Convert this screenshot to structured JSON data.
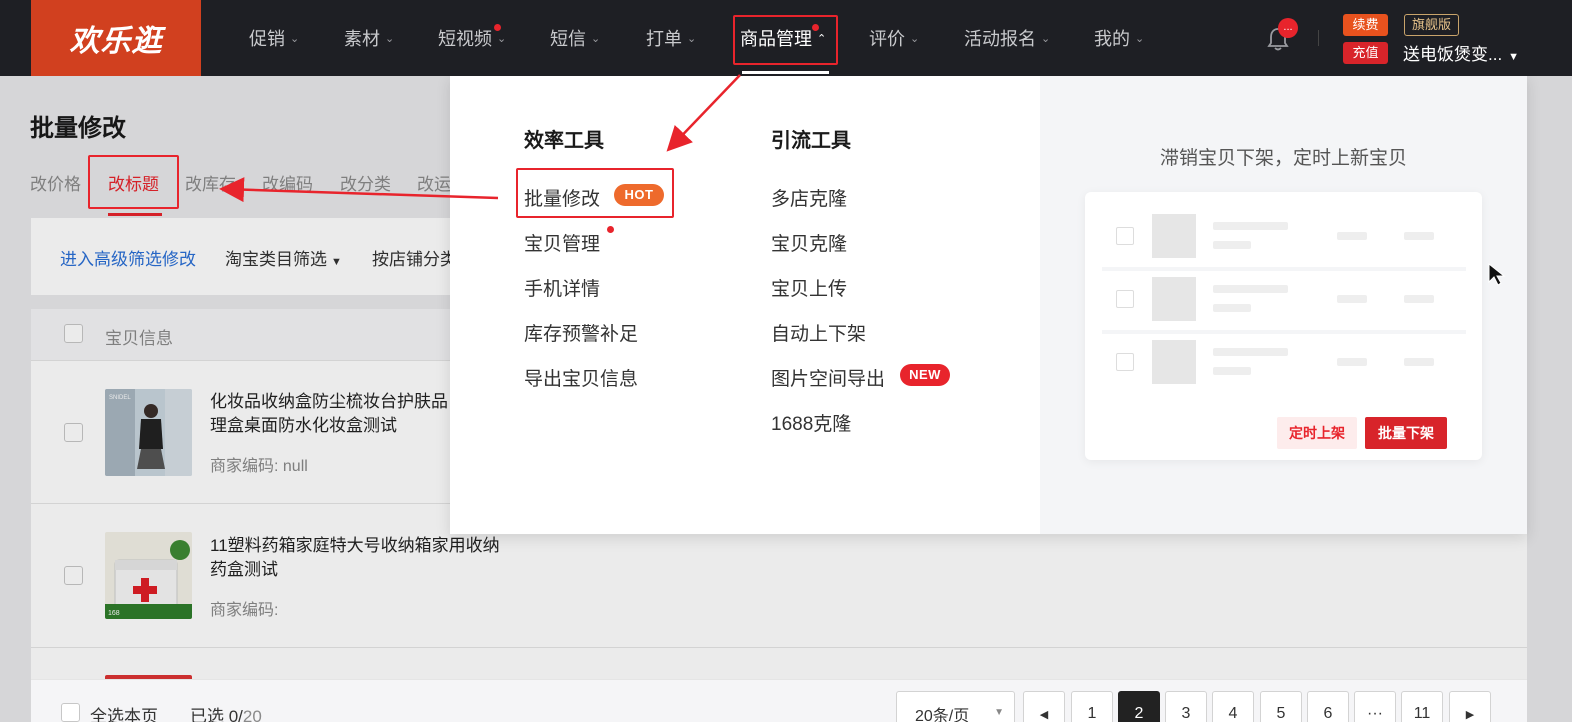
{
  "logo": "欢乐逛",
  "nav": {
    "items": [
      {
        "label": "促销"
      },
      {
        "label": "素材"
      },
      {
        "label": "短视频"
      },
      {
        "label": "短信"
      },
      {
        "label": "打单"
      },
      {
        "label": "商品管理"
      },
      {
        "label": "评价"
      },
      {
        "label": "活动报名"
      },
      {
        "label": "我的"
      }
    ],
    "notification_badge": "...",
    "tag_renew": "续费",
    "tag_flagship": "旗舰版",
    "tag_recharge": "充值",
    "shop_name": "送电饭煲变..."
  },
  "page": {
    "title": "批量修改",
    "subtabs": [
      "改价格",
      "改标题",
      "改库存",
      "改编码",
      "改分类",
      "改运"
    ],
    "filters": {
      "advanced": "进入高级筛选修改",
      "category": "淘宝类目筛选",
      "shop_category": "按店铺分类"
    }
  },
  "table": {
    "header": "宝贝信息",
    "rows": [
      {
        "title": "化妆品收纳盒防尘梳妆台护肤品 储物整理盒桌面防水化妆盒测试",
        "code": "商家编码: null"
      },
      {
        "title": "11塑料药箱家庭特大号收纳箱家用收纳药盒测试",
        "code": "商家编码:"
      }
    ]
  },
  "footer": {
    "select_page": "全选本页",
    "selected_prefix": "已选 0/",
    "selected_total": "20",
    "page_size": "20条/页",
    "pages": [
      "1",
      "2",
      "3",
      "4",
      "5",
      "6",
      "···",
      "11"
    ],
    "current_page": "2"
  },
  "mega_menu": {
    "col1_title": "效率工具",
    "col1_items": [
      "批量修改",
      "宝贝管理",
      "手机详情",
      "库存预警补足",
      "导出宝贝信息"
    ],
    "hot_badge": "HOT",
    "col2_title": "引流工具",
    "col2_items": [
      "多店克隆",
      "宝贝克隆",
      "宝贝上传",
      "自动上下架",
      "图片空间导出",
      "1688克隆"
    ],
    "new_badge": "NEW",
    "promo_title": "滞销宝贝下架，定时上新宝贝",
    "promo_btn_schedule": "定时上架",
    "promo_btn_bulk_off": "批量下架"
  },
  "colors": {
    "accent": "#e8242c",
    "topbar": "#1e1f24",
    "logo_bg": "#d1401f",
    "link_blue": "#2a6fd6",
    "hot_orange": "#ee6a2c"
  }
}
